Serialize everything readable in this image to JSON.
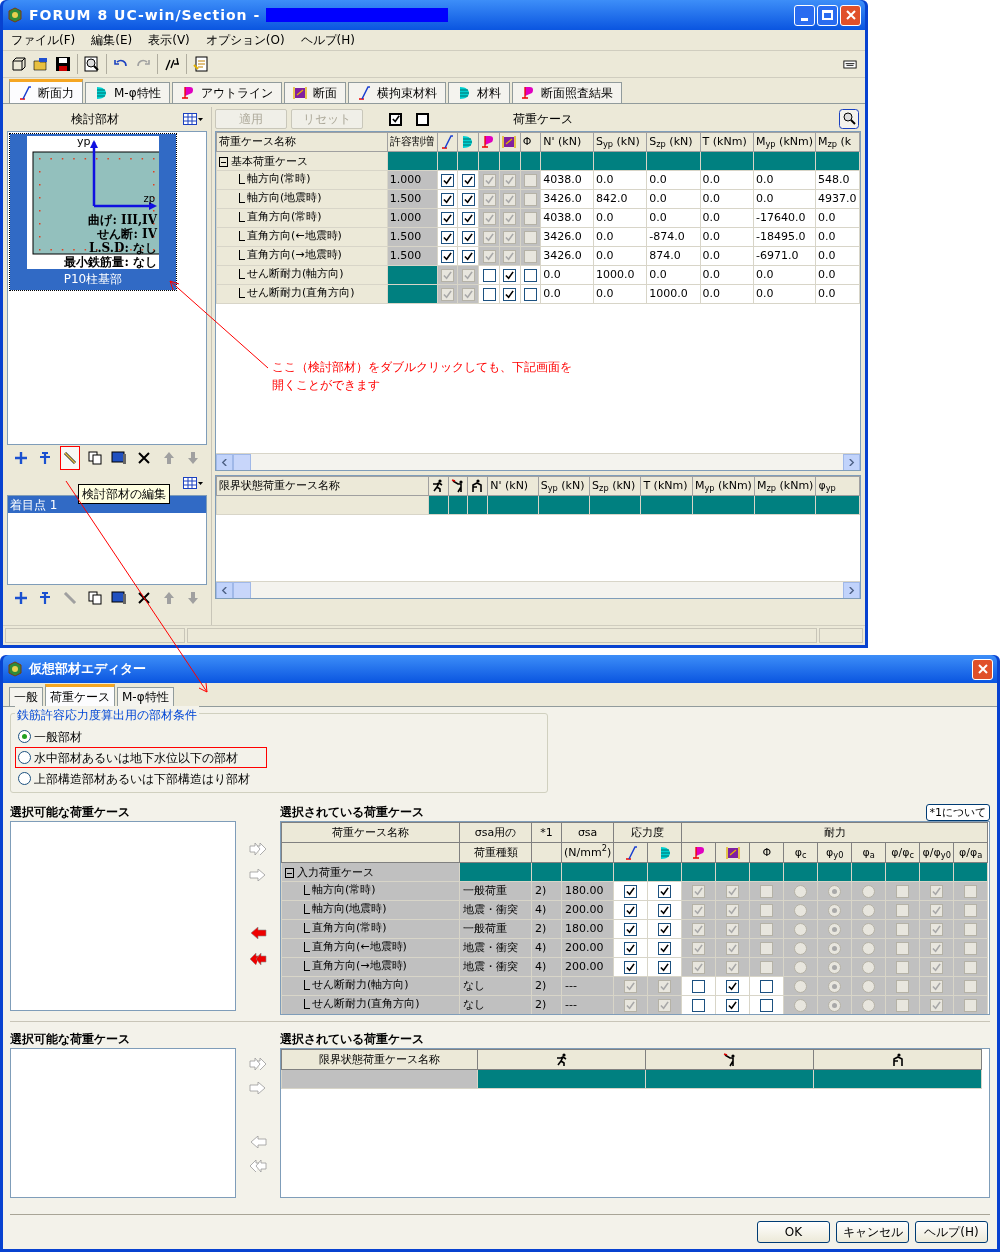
{
  "main_window": {
    "title": "FORUM 8  UC-win/Section -",
    "menu": [
      "ファイル(F)",
      "編集(E)",
      "表示(V)",
      "オプション(O)",
      "ヘルプ(H)"
    ],
    "toolbar": [
      {
        "kind": "new",
        "disabled": false
      },
      {
        "kind": "open",
        "disabled": false
      },
      {
        "kind": "save",
        "disabled": false
      },
      {
        "kind": "preview",
        "disabled": false
      },
      {
        "kind": "undo",
        "disabled": false
      },
      {
        "kind": "redo",
        "disabled": true
      },
      {
        "kind": "tool",
        "disabled": false
      },
      {
        "kind": "report",
        "disabled": false
      }
    ],
    "tabs": [
      {
        "label": "断面力",
        "selected": true
      },
      {
        "label": "M-φ特性",
        "selected": false
      },
      {
        "label": "アウトライン",
        "selected": false
      },
      {
        "label": "断面",
        "selected": false
      },
      {
        "label": "横拘束材料",
        "selected": false
      },
      {
        "label": "材料",
        "selected": false
      },
      {
        "label": "断面照査結果",
        "selected": false
      }
    ],
    "member_panel": {
      "title": "検討部材",
      "members": [
        {
          "name": "P10柱基部",
          "axis_y": "yp",
          "axis_z": "zp",
          "labels": [
            "曲げ: III,IV",
            "せん断: IV",
            "L.S.D: なし",
            "最小鉄筋量: なし"
          ],
          "selected": true
        }
      ],
      "tools": [
        {
          "kind": "add",
          "disabled": false,
          "highlighted": false
        },
        {
          "kind": "insert",
          "disabled": false,
          "highlighted": false
        },
        {
          "kind": "edit",
          "disabled": false,
          "highlighted": true
        },
        {
          "kind": "copy",
          "disabled": false,
          "highlighted": false
        },
        {
          "kind": "paste",
          "disabled": false,
          "highlighted": false
        },
        {
          "kind": "delete",
          "disabled": false,
          "highlighted": false
        },
        {
          "kind": "up",
          "disabled": true,
          "highlighted": false
        },
        {
          "kind": "down",
          "disabled": true,
          "highlighted": false
        }
      ]
    },
    "point_panel": {
      "points": [
        {
          "label": "着目点 1",
          "selected": true
        }
      ],
      "tools": [
        {
          "kind": "add",
          "disabled": false
        },
        {
          "kind": "insert",
          "disabled": false
        },
        {
          "kind": "edit",
          "disabled": true
        },
        {
          "kind": "copy",
          "disabled": false
        },
        {
          "kind": "paste",
          "disabled": false
        },
        {
          "kind": "delete",
          "disabled": false
        },
        {
          "kind": "up",
          "disabled": true
        },
        {
          "kind": "down",
          "disabled": true
        }
      ]
    },
    "tooltip": "検討部材の編集",
    "action_buttons": [
      {
        "label": "適用",
        "disabled": true
      },
      {
        "label": "リセット",
        "disabled": true
      }
    ],
    "load_case_title": "荷重ケース",
    "case_grid": {
      "name_header": "荷重ケース名称",
      "factor_header": "許容割増",
      "phi_header": "Φ",
      "value_headers": [
        "N' (kN)",
        "S$_{yp}$ (kN)",
        "S$_{zp}$ (kN)",
        "T (kNm)",
        "M$_{yp}$ (kNm)",
        "M$_{zp}$ (k"
      ],
      "group": "基本荷重ケース",
      "rows": [
        {
          "name": "軸方向(常時)",
          "factor": "1.000",
          "checks": [
            {
              "checked": true,
              "disabled": false
            },
            {
              "checked": true,
              "disabled": false
            },
            {
              "checked": true,
              "disabled": true
            },
            {
              "checked": true,
              "disabled": true
            },
            {
              "checked": false,
              "disabled": true
            }
          ],
          "values": [
            "4038.0",
            "0.0",
            "0.0",
            "0.0",
            "0.0",
            "548.0"
          ]
        },
        {
          "name": "軸方向(地震時)",
          "factor": "1.500",
          "checks": [
            {
              "checked": true,
              "disabled": false
            },
            {
              "checked": true,
              "disabled": false
            },
            {
              "checked": true,
              "disabled": true
            },
            {
              "checked": true,
              "disabled": true
            },
            {
              "checked": false,
              "disabled": true
            }
          ],
          "values": [
            "3426.0",
            "842.0",
            "0.0",
            "0.0",
            "0.0",
            "4937.0"
          ]
        },
        {
          "name": "直角方向(常時)",
          "factor": "1.000",
          "checks": [
            {
              "checked": true,
              "disabled": false
            },
            {
              "checked": true,
              "disabled": false
            },
            {
              "checked": true,
              "disabled": true
            },
            {
              "checked": true,
              "disabled": true
            },
            {
              "checked": false,
              "disabled": true
            }
          ],
          "values": [
            "4038.0",
            "0.0",
            "0.0",
            "0.0",
            "-17640.0",
            "0.0"
          ]
        },
        {
          "name": "直角方向(←地震時)",
          "factor": "1.500",
          "checks": [
            {
              "checked": true,
              "disabled": false
            },
            {
              "checked": true,
              "disabled": false
            },
            {
              "checked": true,
              "disabled": true
            },
            {
              "checked": true,
              "disabled": true
            },
            {
              "checked": false,
              "disabled": true
            }
          ],
          "values": [
            "3426.0",
            "0.0",
            "-874.0",
            "0.0",
            "-18495.0",
            "0.0"
          ]
        },
        {
          "name": "直角方向(→地震時)",
          "factor": "1.500",
          "checks": [
            {
              "checked": true,
              "disabled": false
            },
            {
              "checked": true,
              "disabled": false
            },
            {
              "checked": true,
              "disabled": true
            },
            {
              "checked": true,
              "disabled": true
            },
            {
              "checked": false,
              "disabled": true
            }
          ],
          "values": [
            "3426.0",
            "0.0",
            "874.0",
            "0.0",
            "-6971.0",
            "0.0"
          ]
        },
        {
          "name": "せん断耐力(軸方向)",
          "checks": [
            {
              "checked": true,
              "disabled": true
            },
            {
              "checked": true,
              "disabled": true
            },
            {
              "checked": false,
              "disabled": false
            },
            {
              "checked": true,
              "disabled": false
            },
            {
              "checked": false,
              "disabled": false
            }
          ],
          "values": [
            "0.0",
            "1000.0",
            "0.0",
            "0.0",
            "0.0",
            "0.0"
          ]
        },
        {
          "name": "せん断耐力(直角方向)",
          "checks": [
            {
              "checked": true,
              "disabled": true
            },
            {
              "checked": true,
              "disabled": true
            },
            {
              "checked": false,
              "disabled": false
            },
            {
              "checked": true,
              "disabled": false
            },
            {
              "checked": false,
              "disabled": false
            }
          ],
          "values": [
            "0.0",
            "0.0",
            "1000.0",
            "0.0",
            "0.0",
            "0.0"
          ]
        }
      ]
    },
    "limit_grid": {
      "name_header": "限界状態荷重ケース名称",
      "value_headers": [
        "N' (kN)",
        "S$_{yp}$ (kN)",
        "S$_{zp}$ (kN)",
        "T (kNm)",
        "M$_{yp}$ (kNm)",
        "M$_{zp}$ (kNm)",
        "φ$_{yp}$"
      ]
    },
    "annotation": "ここ（検討部材）をダブルクリックしても、下記画面を開くことができます"
  },
  "dialog": {
    "title": "仮想部材エディター",
    "tabs": [
      {
        "label": "一般",
        "selected": false
      },
      {
        "label": "荷重ケース",
        "selected": true
      },
      {
        "label": "M-φ特性",
        "selected": false
      }
    ],
    "condition_group": {
      "title": "鉄筋許容応力度算出用の部材条件",
      "options": [
        {
          "label": "一般部材",
          "selected": true,
          "highlighted": false
        },
        {
          "label": "水中部材あるいは地下水位以下の部材",
          "selected": false,
          "highlighted": true
        },
        {
          "label": "上部構造部材あるいは下部構造はり部材",
          "selected": false,
          "highlighted": false
        }
      ]
    },
    "available_title": "選択可能な荷重ケース",
    "selected_title": "選択されている荷重ケース",
    "note_button": "*1について",
    "transfer_buttons": [
      {
        "kind": "add-all",
        "disabled": true
      },
      {
        "kind": "add",
        "disabled": true
      },
      {
        "kind": "remove",
        "disabled": false
      },
      {
        "kind": "remove-all",
        "disabled": false
      }
    ],
    "case_grid": {
      "top_headers": [
        "荷重ケース名称",
        "σsa用の",
        "*1",
        "σsa",
        "応力度",
        "耐力"
      ],
      "type_header": "荷重種類",
      "unit_header": "(N/mm$^{2}$)",
      "phi_header": "Φ",
      "capacity_headers": [
        "φ$_{c}$",
        "φ$_{y0}$",
        "φ$_{a}$",
        "φ/φ$_{c}$",
        "φ/φ$_{y0}$",
        "φ/φ$_{a}$"
      ],
      "group": "入力荷重ケース",
      "rows": [
        {
          "name": "軸方向(常時)",
          "type": "一般荷重",
          "note": "2)",
          "sigma": "180.00",
          "stress": [
            {
              "checked": true,
              "disabled": false
            },
            {
              "checked": true,
              "disabled": false
            }
          ],
          "capacity": [
            {
              "checked": true,
              "disabled": true
            },
            {
              "checked": true,
              "disabled": true
            },
            {
              "checked": false,
              "disabled": true
            }
          ],
          "phi": [
            {
              "selected": false,
              "disabled": true
            },
            {
              "selected": true,
              "disabled": true
            },
            {
              "selected": false,
              "disabled": true
            }
          ],
          "ratio": [
            {
              "checked": false,
              "disabled": true
            },
            {
              "checked": true,
              "disabled": true
            },
            {
              "checked": false,
              "disabled": true
            }
          ]
        },
        {
          "name": "軸方向(地震時)",
          "type": "地震・衝突",
          "note": "4)",
          "sigma": "200.00",
          "stress": [
            {
              "checked": true,
              "disabled": false
            },
            {
              "checked": true,
              "disabled": false
            }
          ],
          "capacity": [
            {
              "checked": true,
              "disabled": true
            },
            {
              "checked": true,
              "disabled": true
            },
            {
              "checked": false,
              "disabled": true
            }
          ],
          "phi": [
            {
              "selected": false,
              "disabled": true
            },
            {
              "selected": true,
              "disabled": true
            },
            {
              "selected": false,
              "disabled": true
            }
          ],
          "ratio": [
            {
              "checked": false,
              "disabled": true
            },
            {
              "checked": true,
              "disabled": true
            },
            {
              "checked": false,
              "disabled": true
            }
          ]
        },
        {
          "name": "直角方向(常時)",
          "type": "一般荷重",
          "note": "2)",
          "sigma": "180.00",
          "stress": [
            {
              "checked": true,
              "disabled": false
            },
            {
              "checked": true,
              "disabled": false
            }
          ],
          "capacity": [
            {
              "checked": true,
              "disabled": true
            },
            {
              "checked": true,
              "disabled": true
            },
            {
              "checked": false,
              "disabled": true
            }
          ],
          "phi": [
            {
              "selected": false,
              "disabled": true
            },
            {
              "selected": true,
              "disabled": true
            },
            {
              "selected": false,
              "disabled": true
            }
          ],
          "ratio": [
            {
              "checked": false,
              "disabled": true
            },
            {
              "checked": true,
              "disabled": true
            },
            {
              "checked": false,
              "disabled": true
            }
          ]
        },
        {
          "name": "直角方向(←地震時)",
          "type": "地震・衝突",
          "note": "4)",
          "sigma": "200.00",
          "stress": [
            {
              "checked": true,
              "disabled": false
            },
            {
              "checked": true,
              "disabled": false
            }
          ],
          "capacity": [
            {
              "checked": true,
              "disabled": true
            },
            {
              "checked": true,
              "disabled": true
            },
            {
              "checked": false,
              "disabled": true
            }
          ],
          "phi": [
            {
              "selected": false,
              "disabled": true
            },
            {
              "selected": true,
              "disabled": true
            },
            {
              "selected": false,
              "disabled": true
            }
          ],
          "ratio": [
            {
              "checked": false,
              "disabled": true
            },
            {
              "checked": true,
              "disabled": true
            },
            {
              "checked": false,
              "disabled": true
            }
          ]
        },
        {
          "name": "直角方向(→地震時)",
          "type": "地震・衝突",
          "note": "4)",
          "sigma": "200.00",
          "stress": [
            {
              "checked": true,
              "disabled": false
            },
            {
              "checked": true,
              "disabled": false
            }
          ],
          "capacity": [
            {
              "checked": true,
              "disabled": true
            },
            {
              "checked": true,
              "disabled": true
            },
            {
              "checked": false,
              "disabled": true
            }
          ],
          "phi": [
            {
              "selected": false,
              "disabled": true
            },
            {
              "selected": true,
              "disabled": true
            },
            {
              "selected": false,
              "disabled": true
            }
          ],
          "ratio": [
            {
              "checked": false,
              "disabled": true
            },
            {
              "checked": true,
              "disabled": true
            },
            {
              "checked": false,
              "disabled": true
            }
          ]
        },
        {
          "name": "せん断耐力(軸方向)",
          "type": "なし",
          "note": "2)",
          "sigma": "---",
          "stress": [
            {
              "checked": true,
              "disabled": true
            },
            {
              "checked": true,
              "disabled": true
            }
          ],
          "capacity": [
            {
              "checked": false,
              "disabled": false
            },
            {
              "checked": true,
              "disabled": false
            },
            {
              "checked": false,
              "disabled": false
            }
          ],
          "phi": [
            {
              "selected": false,
              "disabled": true
            },
            {
              "selected": true,
              "disabled": true
            },
            {
              "selected": false,
              "disabled": true
            }
          ],
          "ratio": [
            {
              "checked": false,
              "disabled": true
            },
            {
              "checked": true,
              "disabled": true
            },
            {
              "checked": false,
              "disabled": true
            }
          ]
        },
        {
          "name": "せん断耐力(直角方向)",
          "type": "なし",
          "note": "2)",
          "sigma": "---",
          "stress": [
            {
              "checked": true,
              "disabled": true
            },
            {
              "checked": true,
              "disabled": true
            }
          ],
          "capacity": [
            {
              "checked": false,
              "disabled": false
            },
            {
              "checked": true,
              "disabled": false
            },
            {
              "checked": false,
              "disabled": false
            }
          ],
          "phi": [
            {
              "selected": false,
              "disabled": true
            },
            {
              "selected": true,
              "disabled": true
            },
            {
              "selected": false,
              "disabled": true
            }
          ],
          "ratio": [
            {
              "checked": false,
              "disabled": true
            },
            {
              "checked": true,
              "disabled": true
            },
            {
              "checked": false,
              "disabled": true
            }
          ]
        }
      ]
    },
    "available_title_2": "選択可能な荷重ケース",
    "selected_title_2": "選択されている荷重ケース",
    "transfer_buttons_2": [
      {
        "kind": "add-all",
        "disabled": true
      },
      {
        "kind": "add",
        "disabled": true
      },
      {
        "kind": "remove",
        "disabled": true
      },
      {
        "kind": "remove-all",
        "disabled": true
      }
    ],
    "limit_grid": {
      "name_header": "限界状態荷重ケース名称"
    },
    "footer_buttons": [
      "OK",
      "キャンセル",
      "ヘルプ(H)"
    ]
  }
}
